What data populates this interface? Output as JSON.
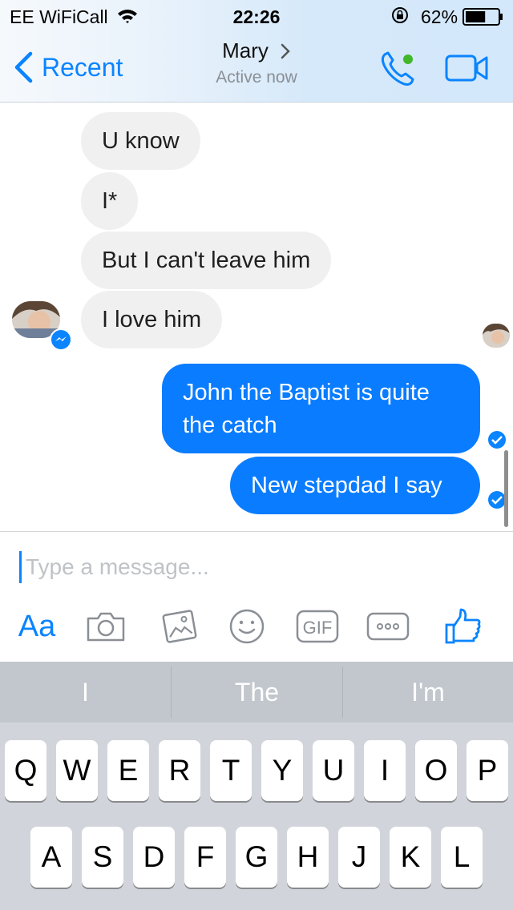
{
  "status_bar": {
    "carrier": "EE WiFiCall",
    "time": "22:26",
    "battery_percent": "62%",
    "battery_level": 0.62
  },
  "header": {
    "back_label": "Recent",
    "contact_name": "Mary",
    "presence": "Active now",
    "accent_color": "#0a84ff",
    "active_dot_color": "#42b72a"
  },
  "messages": [
    {
      "from": "them",
      "text": "U know"
    },
    {
      "from": "them",
      "text": "I*"
    },
    {
      "from": "them",
      "text": "But I can't leave him"
    },
    {
      "from": "them",
      "text": "I love him"
    },
    {
      "from": "me",
      "text": "John the Baptist is quite the catch"
    },
    {
      "from": "me",
      "text": "New stepdad I say"
    }
  ],
  "composer": {
    "placeholder": "Type a message...",
    "aa_label": "Aa",
    "gif_label": "GIF",
    "tools": [
      "camera-icon",
      "photo-icon",
      "emoji-icon",
      "gif-icon",
      "more-icon",
      "like-icon"
    ]
  },
  "keyboard": {
    "suggestions": [
      "I",
      "The",
      "I'm"
    ],
    "row1": [
      "Q",
      "W",
      "E",
      "R",
      "T",
      "Y",
      "U",
      "I",
      "O",
      "P"
    ],
    "row2": [
      "A",
      "S",
      "D",
      "F",
      "G",
      "H",
      "J",
      "K",
      "L"
    ]
  },
  "colors": {
    "outgoing_bubble": "#0a7cff",
    "incoming_bubble": "#f0f0f0"
  }
}
